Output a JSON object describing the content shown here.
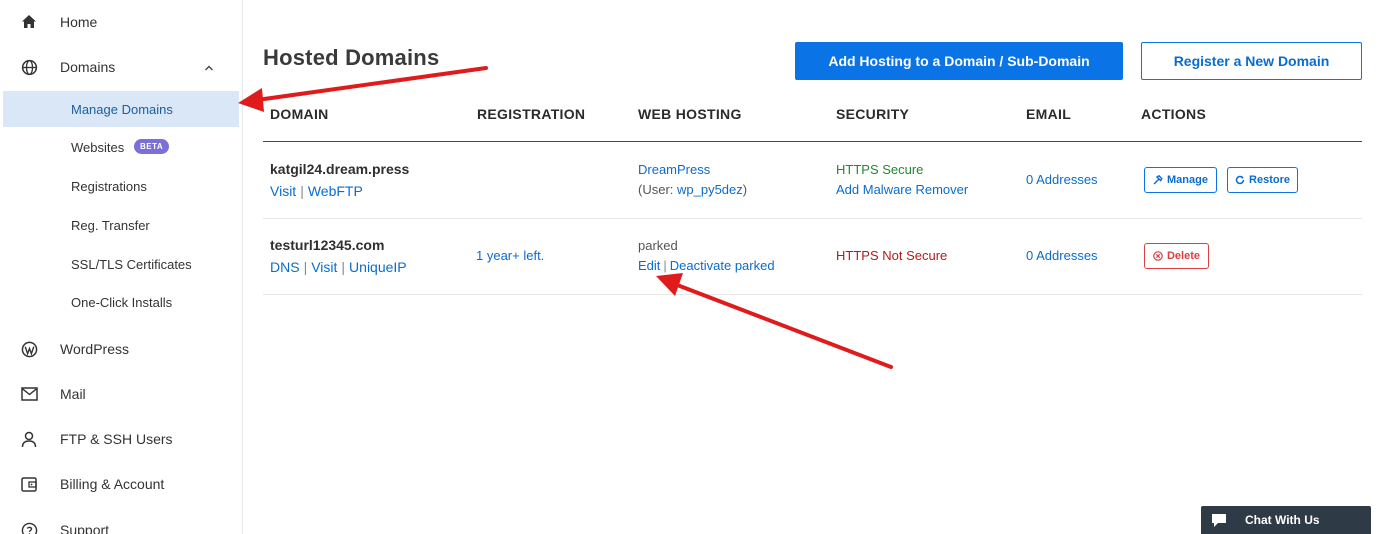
{
  "sidebar": {
    "items": [
      {
        "label": "Home",
        "icon": "home-icon"
      },
      {
        "label": "Domains",
        "icon": "globe-icon",
        "expanded": true
      },
      {
        "label": "WordPress",
        "icon": "wordpress-icon"
      },
      {
        "label": "Mail",
        "icon": "mail-icon"
      },
      {
        "label": "FTP & SSH Users",
        "icon": "user-icon"
      },
      {
        "label": "Billing & Account",
        "icon": "wallet-icon"
      },
      {
        "label": "Support",
        "icon": "help-icon"
      }
    ],
    "subitems": [
      {
        "label": "Manage Domains",
        "active": true
      },
      {
        "label": "Websites",
        "badge": "BETA"
      },
      {
        "label": "Registrations"
      },
      {
        "label": "Reg. Transfer"
      },
      {
        "label": "SSL/TLS Certificates"
      },
      {
        "label": "One-Click Installs"
      }
    ]
  },
  "main": {
    "title": "Hosted Domains",
    "add_hosting_button": "Add Hosting to a Domain / Sub-Domain",
    "register_button": "Register a New Domain",
    "columns": [
      "DOMAIN",
      "REGISTRATION",
      "WEB HOSTING",
      "SECURITY",
      "EMAIL",
      "ACTIONS"
    ],
    "rows": [
      {
        "domain": "katgil24.dream.press",
        "links": [
          "Visit",
          "WebFTP"
        ],
        "registration": "",
        "hosting_line1": "DreamPress",
        "hosting_user_prefix": "(User: ",
        "hosting_user": "wp_py5dez",
        "hosting_user_suffix": ")",
        "security_status": "HTTPS Secure",
        "security_link": "Add Malware Remover",
        "email": "0 Addresses",
        "actions": [
          "Manage",
          "Restore"
        ]
      },
      {
        "domain": "testurl12345.com",
        "links": [
          "DNS",
          "Visit",
          "UniqueIP"
        ],
        "registration": "1 year+ left.",
        "hosting_line1": "parked",
        "hosting_links": [
          "Edit",
          "Deactivate parked"
        ],
        "security_status": "HTTPS Not Secure",
        "email": "0 Addresses",
        "actions": [
          "Delete"
        ]
      }
    ]
  },
  "chat": {
    "label": "Chat With Us"
  },
  "colors": {
    "primary": "#0a74e6",
    "active_bg": "#d9e7f7",
    "secure": "#1e8a2e",
    "insecure": "#b31b1b",
    "danger": "#d94040",
    "annotation_arrow": "#e01b1b",
    "beta_badge": "#7b6fd8"
  }
}
